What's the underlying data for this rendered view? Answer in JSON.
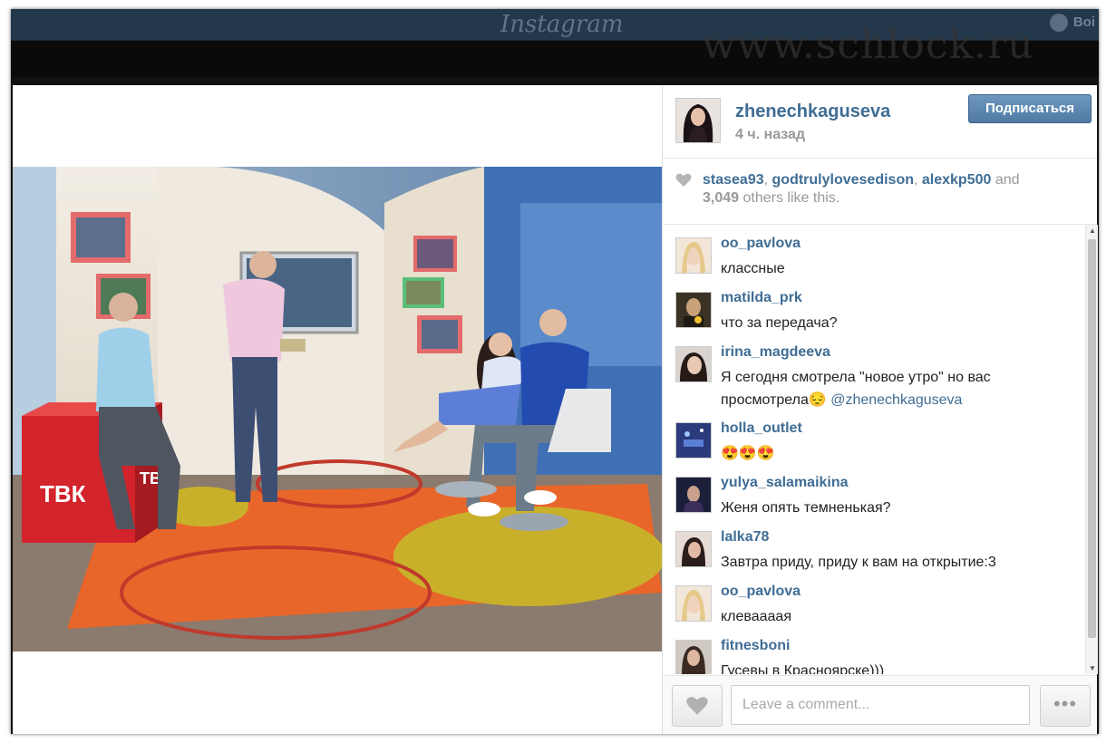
{
  "header": {
    "logo": "Instagram",
    "user_label": "Boi"
  },
  "watermark": "www.schlock.ru",
  "post": {
    "owner": "zhenechkaguseva",
    "time": "4 ч. назад",
    "follow_label": "Подписаться",
    "likes": {
      "users": [
        "stasea93",
        "godtrulylovesedison",
        "alexkp500"
      ],
      "and_word": "and",
      "count": "3,049",
      "suffix": "others like this."
    },
    "comments": [
      {
        "user": "oo_pavlova",
        "text": "классные"
      },
      {
        "user": "matilda_prk",
        "text": "что за передача?"
      },
      {
        "user": "irina_magdeeva",
        "text": "Я сегодня смотрела \"новое утро\" но вас просмотрела😔 ",
        "mention": "@zhenechkaguseva"
      },
      {
        "user": "holla_outlet",
        "text": "😍😍😍"
      },
      {
        "user": "yulya_salamaikina",
        "text": "Женя опять темненькая?"
      },
      {
        "user": "lalka78",
        "text": "Завтра приду, приду к вам на открытие:3"
      },
      {
        "user": "oo_pavlova",
        "text": "клеваааая"
      },
      {
        "user": "fitnesboni",
        "text": "Гусевы в Красноярске)))"
      }
    ],
    "comment_placeholder": "Leave a comment...",
    "more_label": "•••"
  },
  "photo": {
    "studio_logo_front": "ТВК",
    "studio_logo_side": "ТВК"
  },
  "colors": {
    "link": "#3f6d95",
    "header_bg": "#24384c",
    "follow_btn": "#5b86b0"
  }
}
